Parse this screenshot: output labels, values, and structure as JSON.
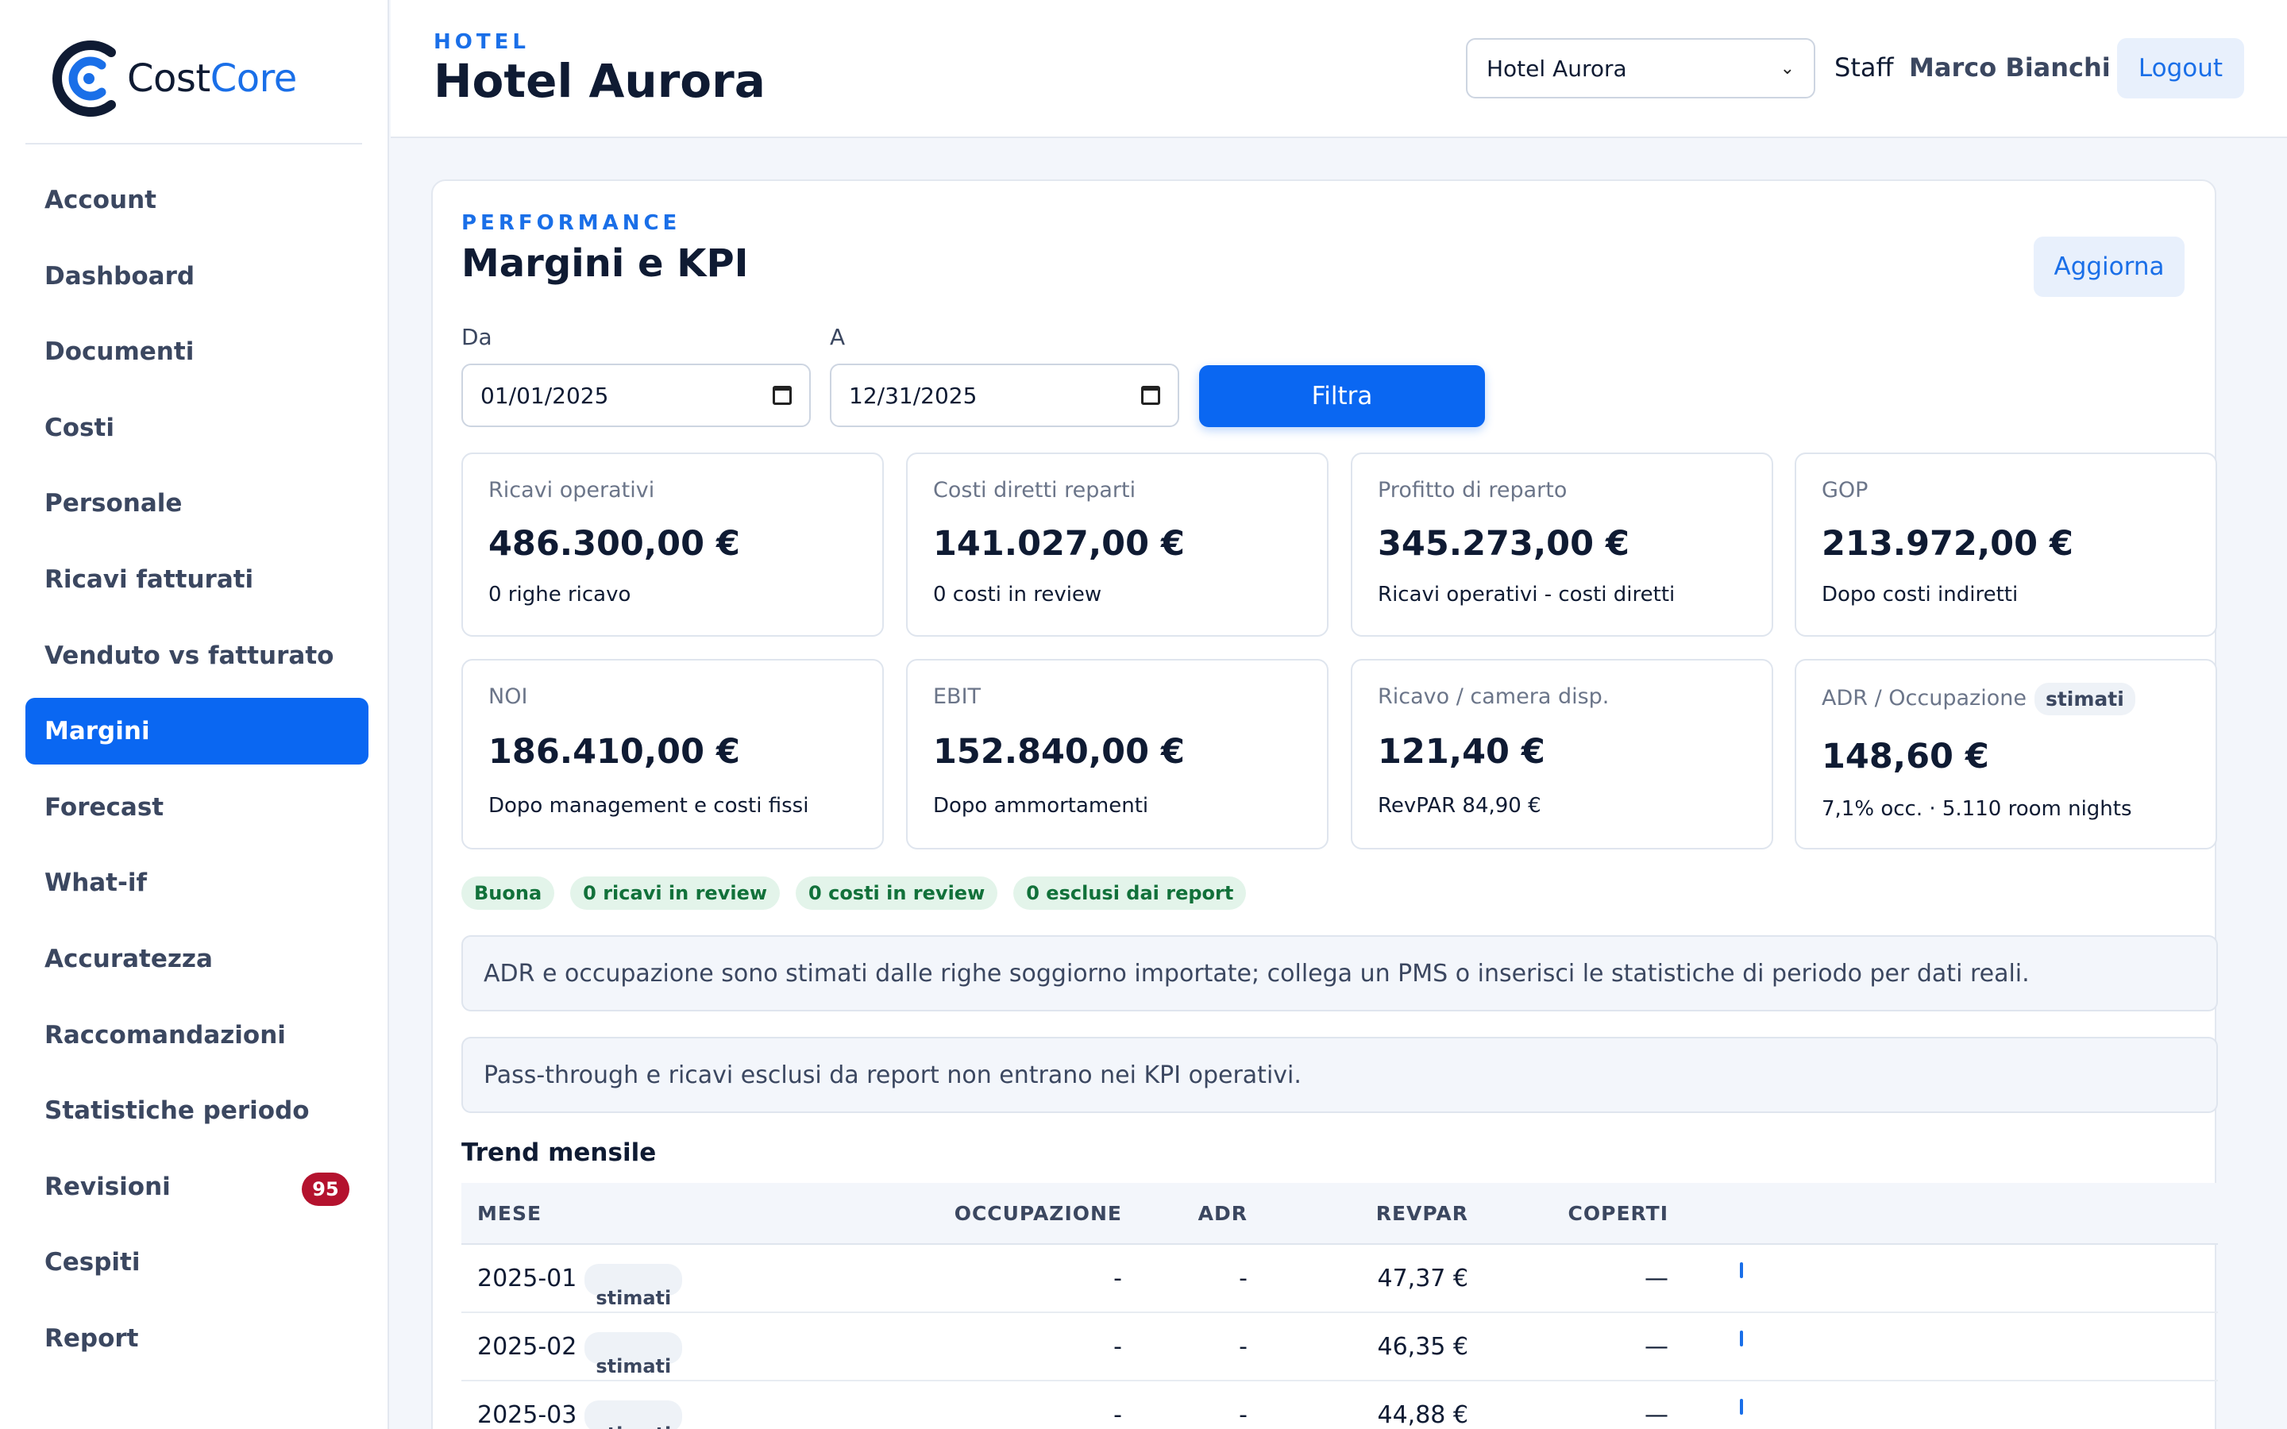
{
  "brand": {
    "name_part1": "Cost",
    "name_part2": "Core",
    "accent": "#1a6fe8",
    "icon": "costcore-logo-icon"
  },
  "sidebar": {
    "items": [
      {
        "label": "Account"
      },
      {
        "label": "Dashboard"
      },
      {
        "label": "Documenti"
      },
      {
        "label": "Costi"
      },
      {
        "label": "Personale"
      },
      {
        "label": "Ricavi fatturati"
      },
      {
        "label": "Venduto vs fatturato"
      },
      {
        "label": "Margini",
        "active": true
      },
      {
        "label": "Forecast"
      },
      {
        "label": "What-if"
      },
      {
        "label": "Accuratezza"
      },
      {
        "label": "Raccomandazioni"
      },
      {
        "label": "Statistiche periodo"
      },
      {
        "label": "Revisioni",
        "badge": "95"
      },
      {
        "label": "Cespiti"
      },
      {
        "label": "Report"
      }
    ]
  },
  "header": {
    "eyebrow": "HOTEL",
    "title": "Hotel Aurora",
    "hotel_select": "Hotel Aurora",
    "role": "Staff",
    "user": "Marco Bianchi",
    "logout": "Logout"
  },
  "card": {
    "eyebrow": "PERFORMANCE",
    "title": "Margini e KPI",
    "refresh": "Aggiorna",
    "from_label": "Da",
    "from_value": "01/01/2025",
    "to_label": "A",
    "to_value": "12/31/2025",
    "filter": "Filtra"
  },
  "kpis": [
    {
      "label": "Ricavi operativi",
      "value": "486.300,00 €",
      "sub": "0 righe ricavo"
    },
    {
      "label": "Costi diretti reparti",
      "value": "141.027,00 €",
      "sub": "0 costi in review"
    },
    {
      "label": "Profitto di reparto",
      "value": "345.273,00 €",
      "sub": "Ricavi operativi - costi diretti"
    },
    {
      "label": "GOP",
      "value": "213.972,00 €",
      "sub": "Dopo costi indiretti"
    },
    {
      "label": "NOI",
      "value": "186.410,00 €",
      "sub": "Dopo management e costi fissi"
    },
    {
      "label": "EBIT",
      "value": "152.840,00 €",
      "sub": "Dopo ammortamenti"
    },
    {
      "label": "Ricavo / camera disp.",
      "value": "121,40 €",
      "sub": "RevPAR 84,90 €"
    },
    {
      "label": "ADR / Occupazione",
      "pill": "stimati",
      "value": "148,60 €",
      "sub": "7,1% occ. · 5.110 room nights"
    }
  ],
  "status_pills": [
    "Buona",
    "0 ricavi in review",
    "0 costi in review",
    "0 esclusi dai report"
  ],
  "notes": [
    "ADR e occupazione sono stimati dalle righe soggiorno importate; collega un PMS o inserisci le statistiche di periodo per dati reali.",
    "Pass-through e ricavi esclusi da report non entrano nei KPI operativi."
  ],
  "trend": {
    "title": "Trend mensile",
    "columns": [
      "MESE",
      "OCCUPAZIONE",
      "ADR",
      "REVPAR",
      "COPERTI"
    ],
    "rows": [
      {
        "mese": "2025-01",
        "pill": "stimati",
        "occ": "-",
        "adr": "-",
        "revpar": "47,37 €",
        "coperti": "—"
      },
      {
        "mese": "2025-02",
        "pill": "stimati",
        "occ": "-",
        "adr": "-",
        "revpar": "46,35 €",
        "coperti": "—"
      },
      {
        "mese": "2025-03",
        "pill": "stimati",
        "occ": "-",
        "adr": "-",
        "revpar": "44,88 €",
        "coperti": "—"
      }
    ]
  }
}
